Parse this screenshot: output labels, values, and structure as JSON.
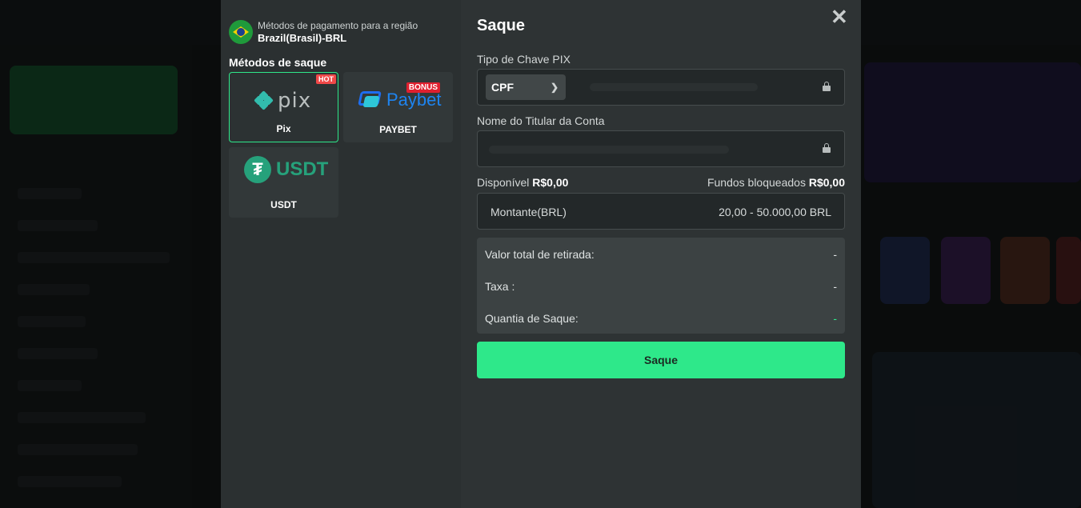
{
  "region": {
    "caption": "Métodos de pagamento para a região",
    "name": "Brazil(Brasil)-BRL"
  },
  "methods": {
    "title": "Métodos de saque",
    "items": [
      {
        "label": "Pix",
        "logo_text": "pix",
        "badge": "HOT",
        "selected": true
      },
      {
        "label": "PAYBET",
        "logo_text": "Paybet",
        "badge": "BONUS",
        "selected": false
      },
      {
        "label": "USDT",
        "logo_text": "USDT",
        "badge": "",
        "selected": false
      }
    ]
  },
  "withdraw": {
    "title": "Saque",
    "close_icon": "close-icon",
    "pix_key_type_label": "Tipo de Chave PIX",
    "pix_key_type_value": "CPF",
    "account_holder_label": "Nome do Titular da Conta",
    "available_label": "Disponível",
    "available_value": "R$0,00",
    "blocked_label": "Fundos bloqueados",
    "blocked_value": "R$0,00",
    "amount_placeholder": "Montante(BRL)",
    "amount_range": "20,00 - 50.000,00 BRL",
    "summary": [
      {
        "label": "Valor total de retirada:",
        "value": "-"
      },
      {
        "label": "Taxa :",
        "value": "-"
      },
      {
        "label": "Quantia de Saque:",
        "value": "-"
      }
    ],
    "submit_label": "Saque"
  },
  "colors": {
    "accent": "#2ee88a",
    "modal_left": "#2b3031",
    "modal_right": "#2e3334",
    "hot_badge": "#f04848",
    "bonus_badge": "#e0202f"
  }
}
